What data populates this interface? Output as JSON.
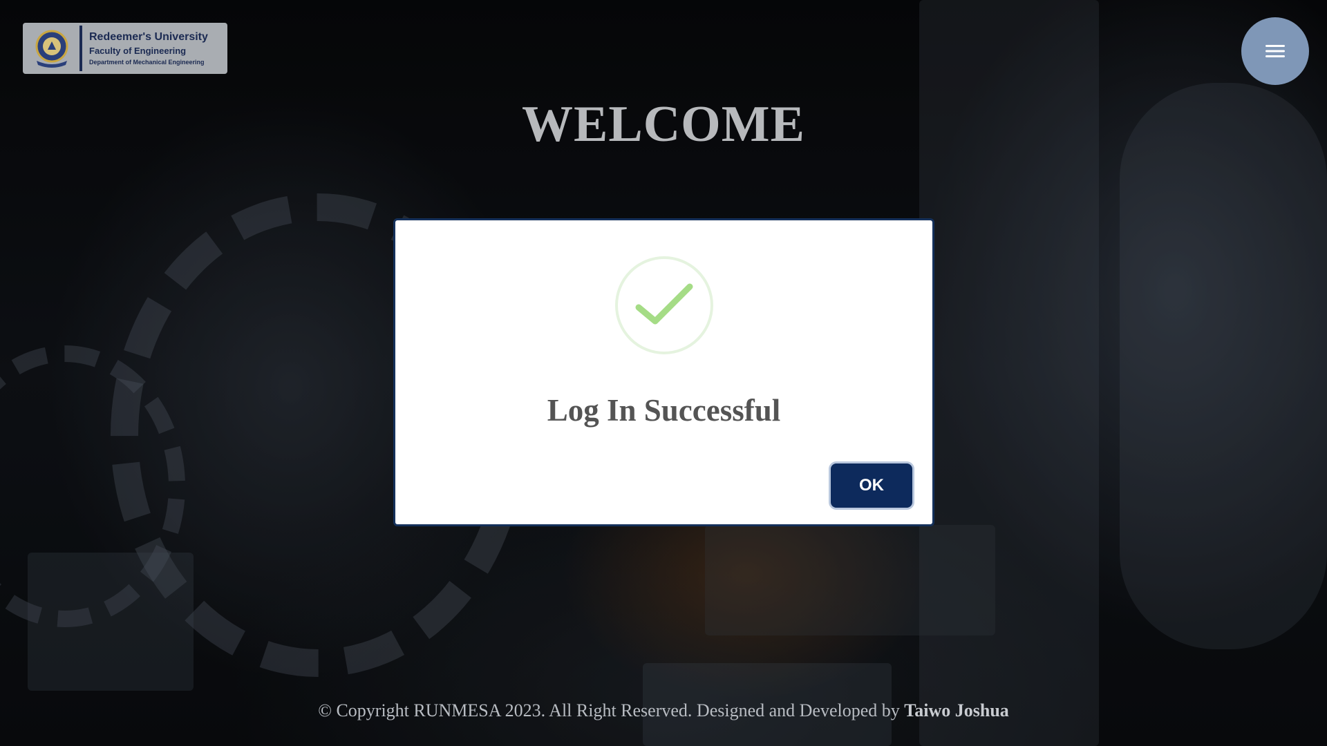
{
  "logo": {
    "university": "Redeemer's University",
    "faculty": "Faculty of Engineering",
    "department": "Department of Mechanical Engineering",
    "seal_icon": "university-seal-icon"
  },
  "menu": {
    "icon": "hamburger-menu-icon"
  },
  "header": {
    "welcome": "WELCOME"
  },
  "dialog": {
    "icon": "check-icon",
    "title": "Log In Successful",
    "ok_label": "OK"
  },
  "footer": {
    "copyright": "© Copyright RUNMESA 2023. All Right Reserved. Designed and Developed by",
    "developer": "Taiwo Joshua"
  },
  "colors": {
    "primary": "#0d2a5c",
    "menu_button": "#7f97b7",
    "check": "#a5dc86"
  }
}
